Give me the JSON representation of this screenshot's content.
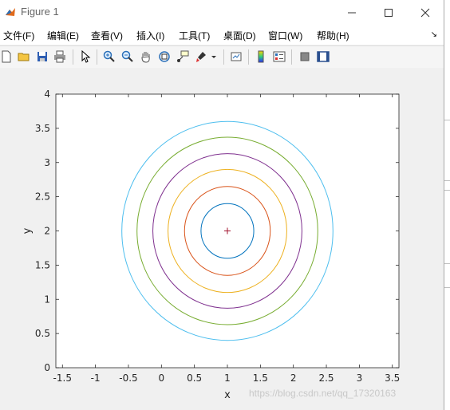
{
  "window": {
    "title": "Figure 1",
    "minimize_icon": "minimize-icon",
    "maximize_icon": "maximize-icon",
    "close_icon": "close-icon"
  },
  "menu": [
    {
      "label": "文件(F)"
    },
    {
      "label": "编辑(E)"
    },
    {
      "label": "查看(V)"
    },
    {
      "label": "插入(I)"
    },
    {
      "label": "工具(T)"
    },
    {
      "label": "桌面(D)"
    },
    {
      "label": "窗口(W)"
    },
    {
      "label": "帮助(H)"
    }
  ],
  "toolbar": [
    "new-figure-icon",
    "open-file-icon",
    "save-icon",
    "print-icon",
    "edit-plot-arrow-icon",
    "zoom-in-icon",
    "zoom-out-icon",
    "pan-hand-icon",
    "rotate-3d-icon",
    "data-cursor-icon",
    "brush-icon",
    "link-plot-icon",
    "colorbar-icon",
    "legend-icon",
    "hide-plot-tools-icon",
    "show-plot-tools-icon"
  ],
  "watermark": "https://blog.csdn.net/qq_17320163",
  "chart_data": {
    "type": "line",
    "title": "",
    "xlabel": "x",
    "ylabel": "y",
    "xlim": [
      -1.6,
      3.6
    ],
    "ylim": [
      0,
      4
    ],
    "xticks": [
      "-1.5",
      "-1",
      "-0.5",
      "0",
      "0.5",
      "1",
      "1.5",
      "2",
      "2.5",
      "3",
      "3.5"
    ],
    "yticks": [
      "0",
      "0.5",
      "1",
      "1.5",
      "2",
      "2.5",
      "3",
      "3.5",
      "4"
    ],
    "xtick_values": [
      -1.5,
      -1,
      -0.5,
      0,
      0.5,
      1,
      1.5,
      2,
      2.5,
      3,
      3.5
    ],
    "ytick_values": [
      0,
      0.5,
      1,
      1.5,
      2,
      2.5,
      3,
      3.5,
      4
    ],
    "grid": false,
    "center": {
      "x": 1,
      "y": 2,
      "marker": "+",
      "color": "#A2142F"
    },
    "series": [
      {
        "radius": 0.4,
        "color": "#0072BD"
      },
      {
        "radius": 0.65,
        "color": "#D95319"
      },
      {
        "radius": 0.9,
        "color": "#EDB120"
      },
      {
        "radius": 1.13,
        "color": "#7E2F8E"
      },
      {
        "radius": 1.37,
        "color": "#77AC30"
      },
      {
        "radius": 1.6,
        "color": "#4DBEEE"
      }
    ]
  }
}
